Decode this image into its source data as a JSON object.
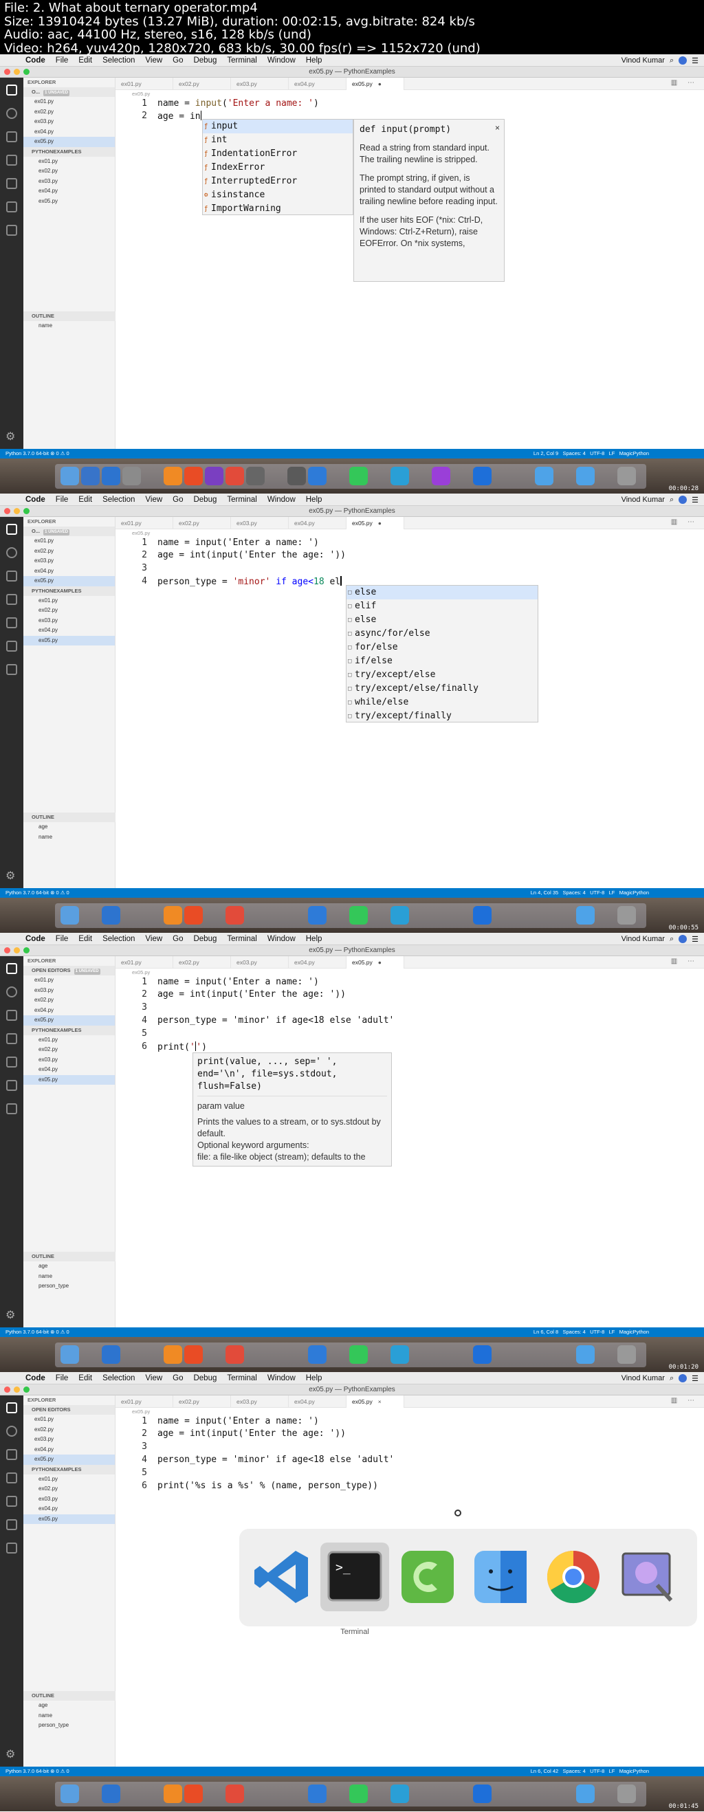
{
  "header": {
    "lines": [
      "File: 2. What about ternary operator.mp4",
      "Size: 13910424 bytes (13.27 MiB), duration: 00:02:15, avg.bitrate: 824 kb/s",
      "Audio: aac, 44100 Hz, stereo, s16, 128 kb/s (und)",
      "Video: h264, yuv420p, 1280x720, 683 kb/s, 30.00 fps(r) => 1152x720 (und)"
    ]
  },
  "menu": {
    "app": "Code",
    "items": [
      "File",
      "Edit",
      "Selection",
      "View",
      "Go",
      "Debug",
      "Terminal",
      "Window",
      "Help"
    ],
    "user": "Vinod Kumar"
  },
  "window_title": "ex05.py — PythonExamples",
  "tabs": [
    "ex01.py",
    "ex02.py",
    "ex03.py",
    "ex04.py",
    "ex05.py"
  ],
  "breadcrumb": "ex05.py",
  "sidebar": {
    "explorer": "EXPLORER",
    "open_editors": "OPEN EDITORS",
    "unsaved": "1 UNSAVED",
    "project": "PYTHONEXAMPLES",
    "files": [
      "ex01.py",
      "ex02.py",
      "ex03.py",
      "ex04.py",
      "ex05.py"
    ],
    "outline": "OUTLINE"
  },
  "status": {
    "python": "Python 3.7.0 64-bit",
    "errors": "0",
    "warnings": "0",
    "spaces": "Spaces: 4",
    "encoding": "UTF-8",
    "eol": "LF",
    "lang": "MagicPython"
  },
  "frames": [
    {
      "timestamp": "00:00:28",
      "position": "Ln 2, Col 9",
      "outline": [
        "name"
      ],
      "code": {
        "l1": {
          "pre": "name = ",
          "fn": "input",
          "open": "(",
          "str": "'Enter a name: '",
          "close": ")"
        },
        "l2": {
          "text": "age = in"
        }
      },
      "suggest": [
        "input",
        "int",
        "IndentationError",
        "IndexError",
        "InterruptedError",
        "isinstance",
        "ImportWarning"
      ],
      "doc": {
        "signature": "def input(prompt)",
        "p1": "Read a string from standard input. The trailing newline is stripped.",
        "p2": "The prompt string, if given, is printed to standard output without a trailing newline before reading input.",
        "p3": "If the user hits EOF (*nix: Ctrl-D, Windows: Ctrl-Z+Return), raise EOFError. On *nix systems,"
      }
    },
    {
      "timestamp": "00:00:55",
      "position": "Ln 4, Col 35",
      "outline": [
        "age",
        "name"
      ],
      "code": {
        "l1": "name = input('Enter a name: ')",
        "l2": "age = int(input('Enter the age: '))",
        "l4": {
          "pre": "person_type = ",
          "str": "'minor'",
          "mid": " if age<",
          "num": "18",
          "end": " el"
        }
      },
      "suggest": [
        "else",
        "elif",
        "else",
        "async/for/else",
        "for/else",
        "if/else",
        "try/except/else",
        "try/except/else/finally",
        "while/else",
        "try/except/finally"
      ]
    },
    {
      "timestamp": "00:01:20",
      "position": "Ln 6, Col 8",
      "outline": [
        "age",
        "name",
        "person_type"
      ],
      "code": {
        "l1": "name = input('Enter a name: ')",
        "l2": "age = int(input('Enter the age: '))",
        "l4": "person_type = 'minor' if age<18 else 'adult'",
        "l6": {
          "pre": "print(",
          "q": "'",
          "q2": "'",
          "close": ")"
        }
      },
      "sighelp": {
        "line1": "print(value, ..., sep=' ',",
        "line2": "end='\\n', file=sys.stdout,",
        "line3": "flush=False)",
        "param": "param value",
        "d1": "Prints the values to a stream, or to sys.stdout by default.",
        "d2": "Optional keyword arguments:",
        "d3": "file: a file-like object (stream); defaults to the"
      }
    },
    {
      "timestamp": "00:01:45",
      "position": "Ln 6, Col 42",
      "outline": [
        "age",
        "name",
        "person_type"
      ],
      "code": {
        "l1": "name = input('Enter a name: ')",
        "l2": "age = int(input('Enter the age: '))",
        "l4": "person_type = 'minor' if age<18 else 'adult'",
        "l6": "print('%s is a %s' % (name, person_type))"
      },
      "switcher_label": "Terminal"
    }
  ],
  "colors": {
    "status_bar": "#007acc",
    "string": "#a31515",
    "keyword": "#0000ff",
    "number": "#09885a"
  }
}
